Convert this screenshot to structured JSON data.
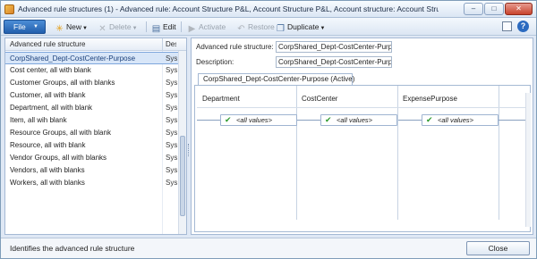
{
  "window": {
    "title": "Advanced rule structures (1) - Advanced rule: Account Structure P&L, Account Structure P&L, Account structure: Account Structure - P&L ..."
  },
  "toolbar": {
    "file_label": "File",
    "new_label": "New",
    "delete_label": "Delete",
    "edit_label": "Edit",
    "activate_label": "Activate",
    "restore_label": "Restore",
    "duplicate_label": "Duplicate"
  },
  "grid": {
    "col1_header": "Advanced rule structure",
    "col2_header": "Desc",
    "rows": [
      {
        "name": "CorpShared_Dept-CostCenter-Purpose",
        "desc": "Syst"
      },
      {
        "name": "Cost center, all with blank",
        "desc": "Syst"
      },
      {
        "name": "Customer Groups, all with blanks",
        "desc": "Syst"
      },
      {
        "name": "Customer, all with blank",
        "desc": "Syst"
      },
      {
        "name": "Department, all with blank",
        "desc": "Syst"
      },
      {
        "name": "Item, all wih blank",
        "desc": "Syst"
      },
      {
        "name": "Resource Groups, all with blank",
        "desc": "Syst"
      },
      {
        "name": "Resource, all with blank",
        "desc": "Syst"
      },
      {
        "name": "Vendor Groups, all with blanks",
        "desc": "Syst"
      },
      {
        "name": "Vendors, all with blanks",
        "desc": "Syst"
      },
      {
        "name": "Workers, all with blanks",
        "desc": "Syst"
      }
    ]
  },
  "details": {
    "structure_label": "Advanced rule structure:",
    "structure_value": "CorpShared_Dept-CostCenter-Purpose",
    "description_label": "Description:",
    "description_value": "CorpShared_Dept-CostCenter-Purpo",
    "tab_label": "CorpShared_Dept-CostCenter-Purpose (Active)"
  },
  "hierarchy": {
    "columns": [
      "Department",
      "CostCenter",
      "ExpensePurpose"
    ],
    "values": [
      "<all values>",
      "<all values>",
      "<all values>"
    ]
  },
  "status": {
    "text": "Identifies the advanced rule structure",
    "close_label": "Close"
  },
  "colors": {
    "accent": "#225fac",
    "selection": "#d8e6f8",
    "check": "#2f9a2f"
  }
}
